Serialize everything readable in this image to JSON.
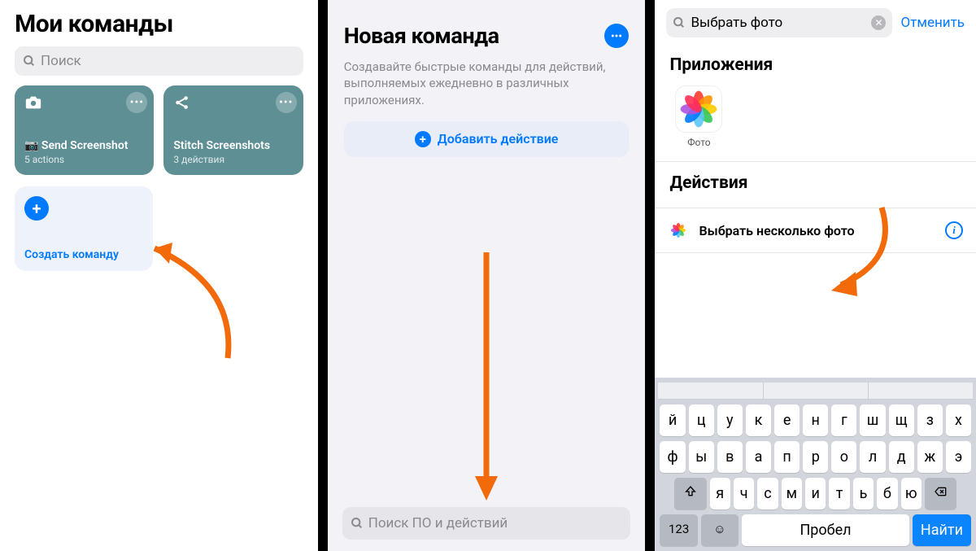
{
  "panel1": {
    "title": "Мои команды",
    "search_placeholder": "Поиск",
    "cards": [
      {
        "name": "📷 Send Screenshot",
        "sub": "5 actions",
        "icon": "camera"
      },
      {
        "name": "Stitch Screenshots",
        "sub": "3 действия",
        "icon": "share"
      }
    ],
    "create_label": "Создать команду"
  },
  "panel2": {
    "title": "Новая команда",
    "description": "Создавайте быстрые команды для действий, выполняемых ежедневно в различных приложениях.",
    "add_action": "Добавить действие",
    "search_placeholder": "Поиск ПО и действий"
  },
  "panel3": {
    "search_value": "Выбрать фото",
    "cancel": "Отменить",
    "apps_title": "Приложения",
    "app_label": "Фото",
    "actions_title": "Действия",
    "action_label": "Выбрать несколько фото",
    "keyboard": {
      "suggestions": [
        "",
        "",
        ""
      ],
      "row1": [
        "й",
        "ц",
        "у",
        "к",
        "е",
        "н",
        "г",
        "ш",
        "щ",
        "з",
        "х"
      ],
      "row2": [
        "ф",
        "ы",
        "в",
        "а",
        "п",
        "р",
        "о",
        "л",
        "д",
        "ж",
        "э"
      ],
      "row3": [
        "я",
        "ч",
        "с",
        "м",
        "и",
        "т",
        "ь",
        "б",
        "ю"
      ],
      "num": "123",
      "space": "Пробел",
      "find": "Найти"
    }
  },
  "colors": {
    "accent": "#007aff",
    "arrow": "#f26a0a"
  }
}
